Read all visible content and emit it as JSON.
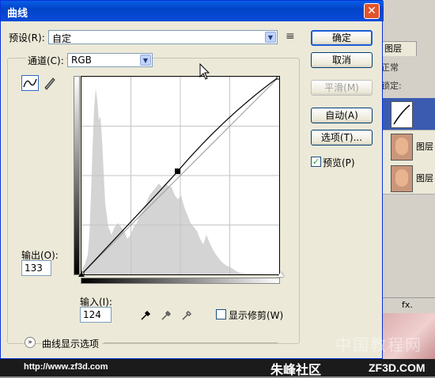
{
  "dialog": {
    "title": "曲线",
    "close_label": "✕"
  },
  "preset": {
    "label": "预设(R):",
    "value": "自定",
    "menu_icon": "≡"
  },
  "channel": {
    "label": "通道(C):",
    "value": "RGB"
  },
  "output": {
    "label": "输出(O):",
    "value": "133"
  },
  "input": {
    "label": "输入(I):",
    "value": "124"
  },
  "buttons": {
    "ok": "确定",
    "cancel": "取消",
    "smooth": "平滑(M)",
    "auto": "自动(A)",
    "options": "选项(T)..."
  },
  "preview": {
    "label": "预览(P)",
    "checked": true
  },
  "show_clipping": {
    "label": "显示修剪(W)",
    "checked": false
  },
  "curve_options": {
    "label": "曲线显示选项",
    "icon": "»"
  },
  "curve": {
    "points": [
      [
        0,
        0
      ],
      [
        124,
        133
      ],
      [
        255,
        255
      ]
    ],
    "input_range": [
      0,
      255
    ],
    "output_range": [
      0,
      255
    ]
  },
  "background_panel": {
    "tab_label": "图层",
    "blend_mode": "正常",
    "lock_label": "锁定:",
    "layers": [
      "",
      "图层",
      "图层"
    ],
    "fx_label": "fx."
  },
  "footer": {
    "url": "http://www.zf3d.com",
    "watermark": "中国教程网",
    "site_name": "朱峰社区",
    "site_domain": "ZF3D.COM"
  }
}
